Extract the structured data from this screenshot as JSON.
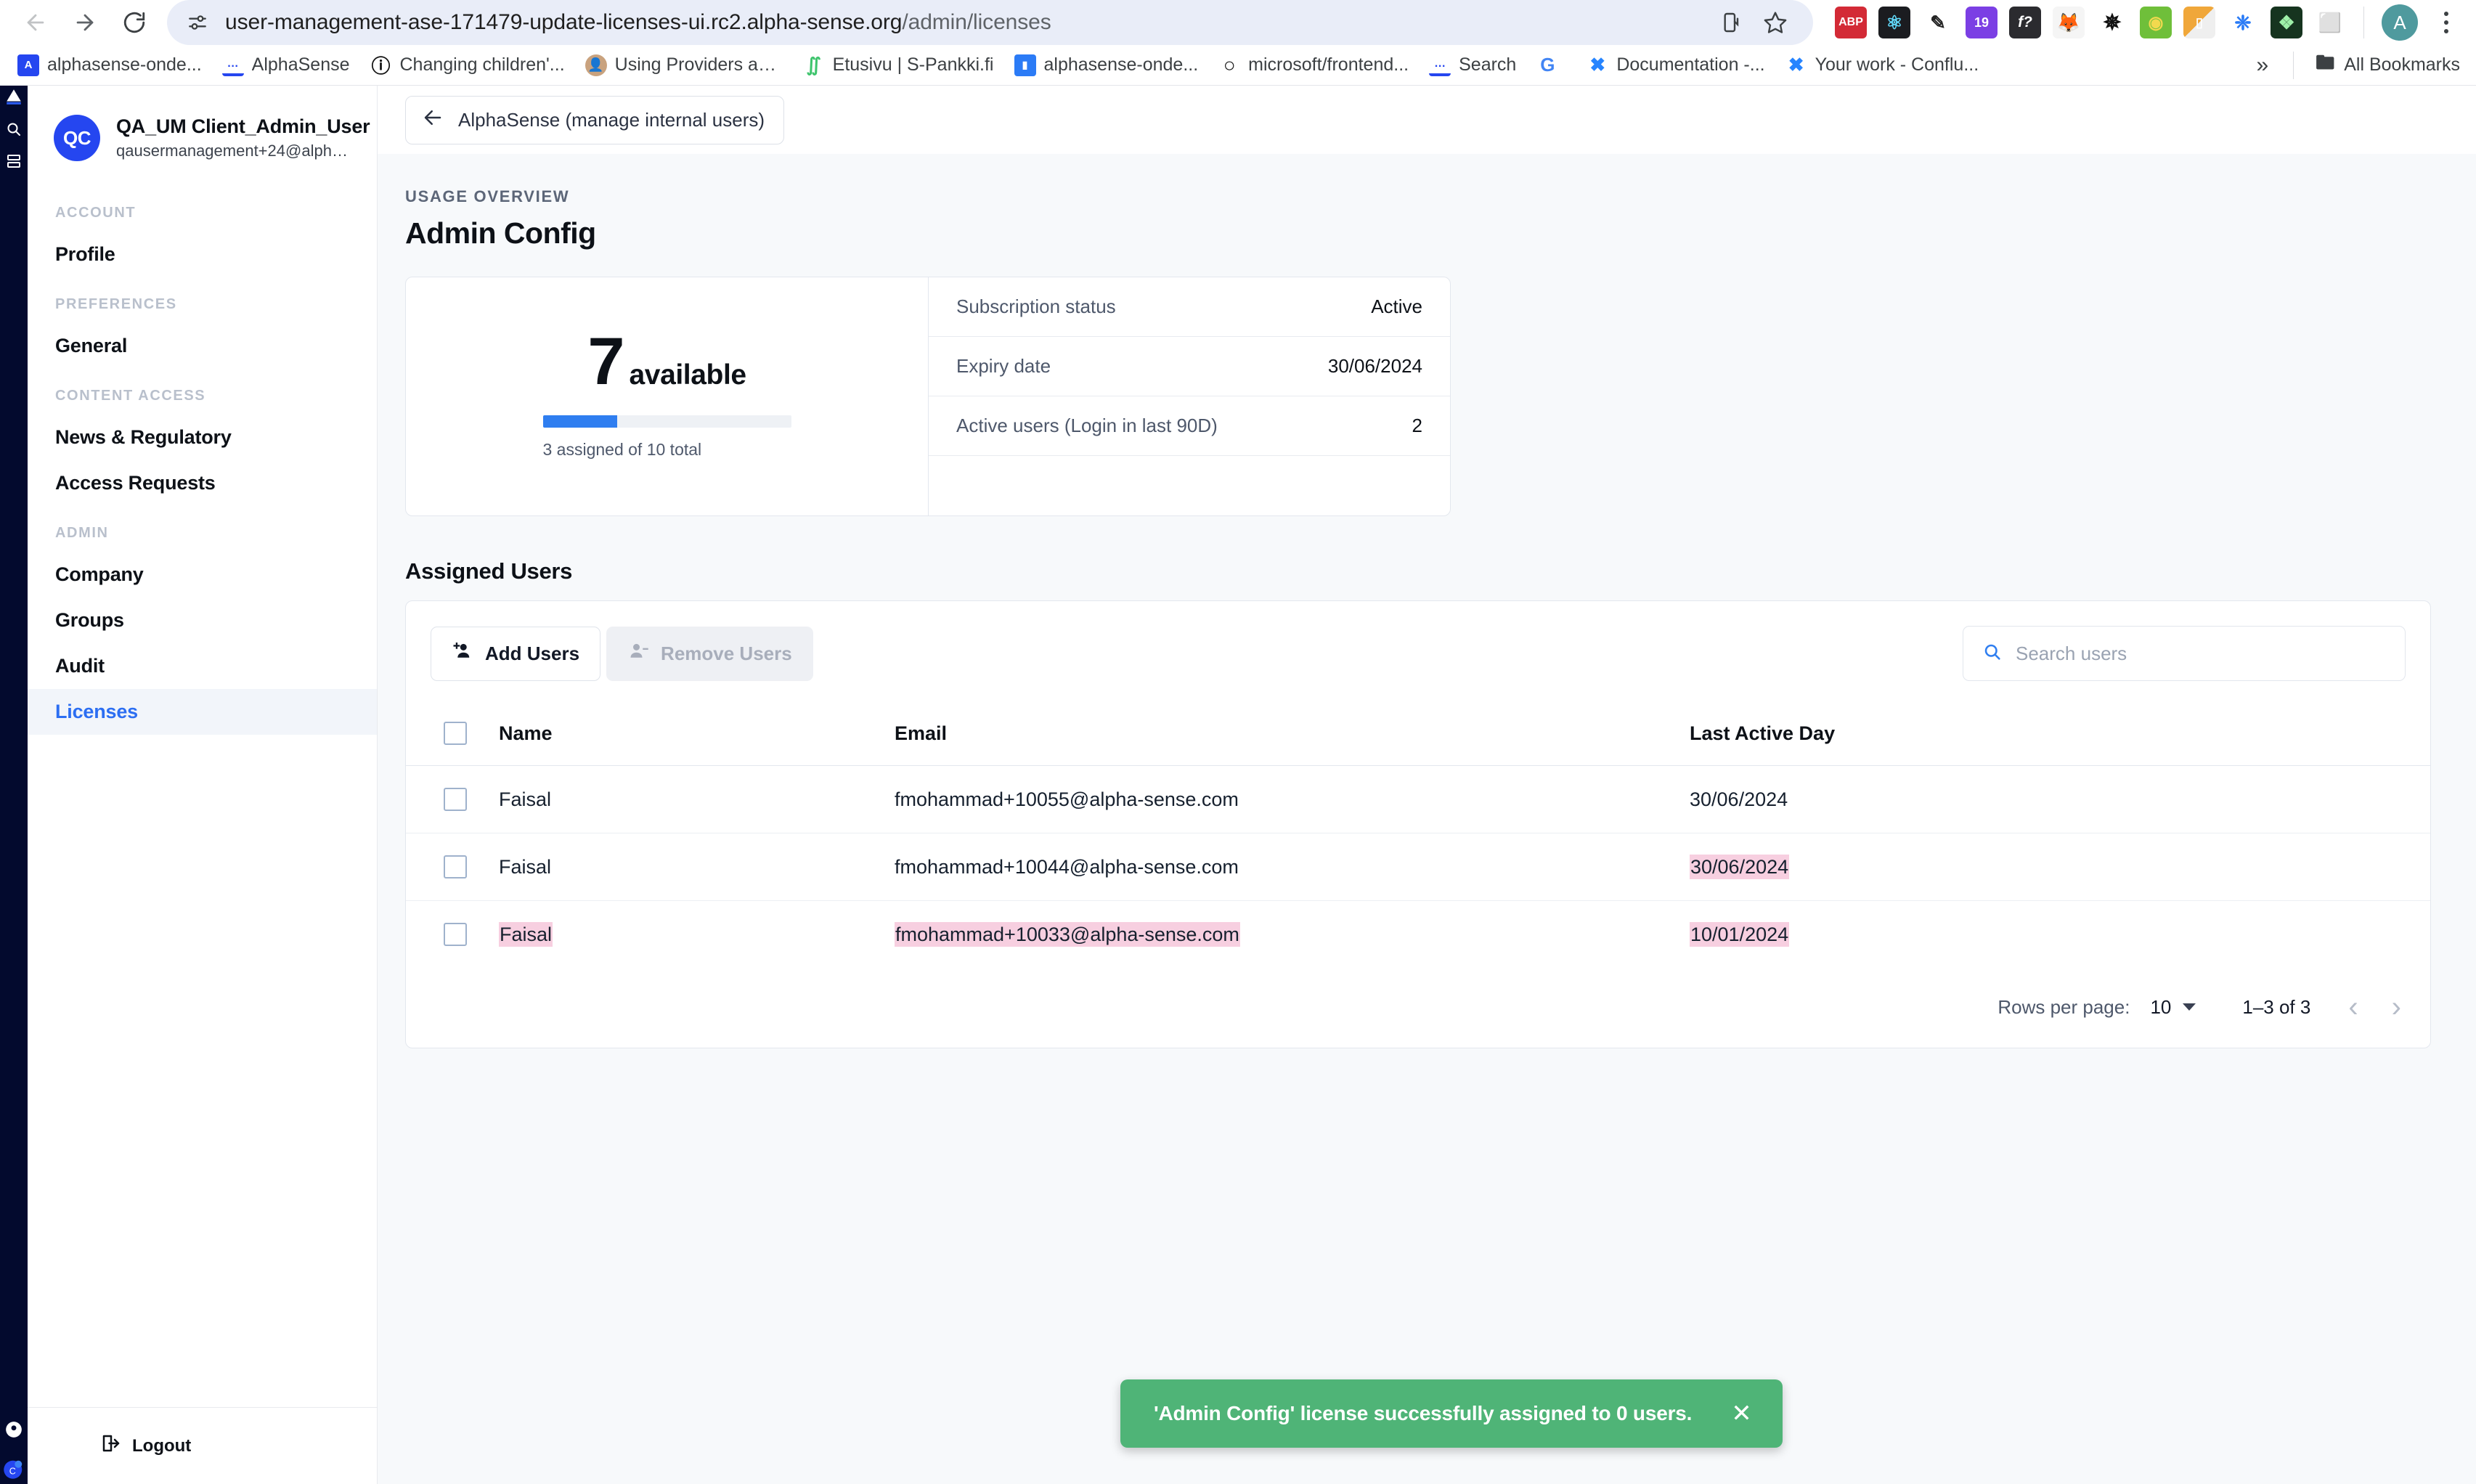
{
  "browser": {
    "nav": {
      "back_icon": "arrow-left-icon",
      "forward_icon": "arrow-right-icon",
      "reload_icon": "reload-icon"
    },
    "omnibox": {
      "tune_icon": "site-settings-icon",
      "url_host": "user-management-ase-171479-update-licenses-ui.rc2.alpha-sense.org",
      "url_path": "/admin/licenses",
      "install_icon": "install-app-icon",
      "bookmark_icon": "star-icon"
    },
    "extensions": [
      {
        "name": "adblock-plus-extension",
        "glyph": "ABP",
        "color": "#d32a36"
      },
      {
        "name": "react-devtools-extension",
        "glyph": "⚛",
        "color": "#1b1c20"
      },
      {
        "name": "eyedropper-extension",
        "glyph": "✒",
        "color": "#ffffff"
      },
      {
        "name": "version-badge-extension",
        "glyph": "19",
        "color": "#7b3fe4"
      },
      {
        "name": "fontface-ninja-extension",
        "glyph": "f?",
        "color": "#2b2b2f"
      },
      {
        "name": "metamask-extension",
        "glyph": "🦊",
        "color": "#f5f5f5"
      },
      {
        "name": "loading-spinner-extension",
        "glyph": "☀",
        "color": "#ffffff"
      },
      {
        "name": "colorzilla-extension",
        "glyph": "◉",
        "color": "#6fbf3a"
      },
      {
        "name": "ruler-extension",
        "glyph": "◥",
        "color": "#f0a73a"
      },
      {
        "name": "jira-extension",
        "glyph": "❈",
        "color": "#2a7bf6"
      },
      {
        "name": "eth-wallet-extension",
        "glyph": "❖",
        "color": "#16341f"
      },
      {
        "name": "clipboard-extension",
        "glyph": "⬜",
        "color": "#ffffff"
      }
    ],
    "profile_initial": "A",
    "menu_icon": "kebab-menu-icon",
    "bookmarks": [
      {
        "label": "alphasense-onde...",
        "favicon": "alphasense-icon",
        "color": "#2546f0",
        "glyph": "A"
      },
      {
        "label": "AlphaSense",
        "favicon": "alphasense-icon",
        "color": "#ffffff",
        "glyph": "ᴀɪ"
      },
      {
        "label": "Changing children'...",
        "favicon": "x-circle-icon",
        "color": "#ffffff",
        "glyph": "Ⓧ"
      },
      {
        "label": "Using Providers an...",
        "favicon": "avatar-icon",
        "color": "#c9a27e",
        "glyph": "👤"
      },
      {
        "label": "Etusivu | S-Pankki.fi",
        "favicon": "s-pankki-icon",
        "color": "#ffffff",
        "glyph": "∬"
      },
      {
        "label": "alphasense-onde...",
        "favicon": "alphasense-icon",
        "color": "#2b7bf6",
        "glyph": "▬"
      },
      {
        "label": "microsoft/frontend...",
        "favicon": "github-icon",
        "color": "#ffffff",
        "glyph": "●"
      },
      {
        "label": "Search",
        "favicon": "alphasense-icon",
        "color": "#ffffff",
        "glyph": "ᴀɪ"
      },
      {
        "label": "",
        "favicon": "google-icon",
        "color": "#ffffff",
        "glyph": "G"
      },
      {
        "label": "Documentation -...",
        "favicon": "confluence-icon",
        "color": "#ffffff",
        "glyph": "✖"
      },
      {
        "label": "Your work - Conflu...",
        "favicon": "confluence-icon",
        "color": "#ffffff",
        "glyph": "✖"
      }
    ],
    "overflow_icon": "chevron-double-right-icon",
    "all_bookmarks_label": "All Bookmarks",
    "all_bookmarks_icon": "folder-icon"
  },
  "sidebar": {
    "user": {
      "initials": "QC",
      "name": "QA_UM Client_Admin_User",
      "email": "qausermanagement+24@alpha-sense...."
    },
    "groups": [
      {
        "label": "ACCOUNT",
        "items": [
          {
            "label": "Profile",
            "active": false
          }
        ]
      },
      {
        "label": "PREFERENCES",
        "items": [
          {
            "label": "General",
            "active": false
          }
        ]
      },
      {
        "label": "CONTENT ACCESS",
        "items": [
          {
            "label": "News & Regulatory",
            "active": false
          },
          {
            "label": "Access Requests",
            "active": false
          }
        ]
      },
      {
        "label": "ADMIN",
        "items": [
          {
            "label": "Company",
            "active": false
          },
          {
            "label": "Groups",
            "active": false
          },
          {
            "label": "Audit",
            "active": false
          },
          {
            "label": "Licenses",
            "active": true
          }
        ]
      }
    ],
    "logout": {
      "label": "Logout",
      "icon": "logout-icon"
    }
  },
  "topbar": {
    "back_label": "AlphaSense (manage internal users)",
    "back_icon": "arrow-left-icon"
  },
  "page": {
    "eyebrow": "USAGE OVERVIEW",
    "title": "Admin Config"
  },
  "usage_card": {
    "available_number": "7",
    "available_word": "available",
    "progress_caption": "3 assigned of 10 total",
    "progress_percent": 30,
    "progress_color": "#2f7ef0",
    "details": [
      {
        "key": "Subscription status",
        "value": "Active"
      },
      {
        "key": "Expiry date",
        "value": "30/06/2024"
      },
      {
        "key": "Active users (Login in last 90D)",
        "value": "2"
      }
    ]
  },
  "assigned_users": {
    "section_title": "Assigned Users",
    "add_users_label": "Add Users",
    "add_users_icon": "person-add-icon",
    "remove_users_label": "Remove Users",
    "remove_users_icon": "person-remove-icon",
    "search": {
      "placeholder": "Search users",
      "value": "",
      "icon": "search-icon"
    },
    "columns": [
      "Name",
      "Email",
      "Last Active Day"
    ],
    "rows": [
      {
        "checked": false,
        "name": "Faisal",
        "email": "fmohammad+10055@alpha-sense.com",
        "last_active": "30/06/2024",
        "highlight": {
          "name": false,
          "email": false,
          "last_active": false
        }
      },
      {
        "checked": false,
        "name": "Faisal",
        "email": "fmohammad+10044@alpha-sense.com",
        "last_active": "30/06/2024",
        "highlight": {
          "name": false,
          "email": false,
          "last_active": true
        }
      },
      {
        "checked": false,
        "name": "Faisal",
        "email": "fmohammad+10033@alpha-sense.com",
        "last_active": "10/01/2024",
        "highlight": {
          "name": true,
          "email": true,
          "last_active": true
        }
      }
    ],
    "highlight_color": "#f7cfe0",
    "pagination": {
      "rows_per_page_label": "Rows per page:",
      "rows_per_page_value": "10",
      "range": "1–3 of 3",
      "prev_icon": "chevron-left-icon",
      "next_icon": "chevron-right-icon"
    }
  },
  "toast": {
    "message": "'Admin Config' license successfully assigned to 0 users.",
    "close_icon": "close-icon",
    "color": "#4fb477"
  }
}
